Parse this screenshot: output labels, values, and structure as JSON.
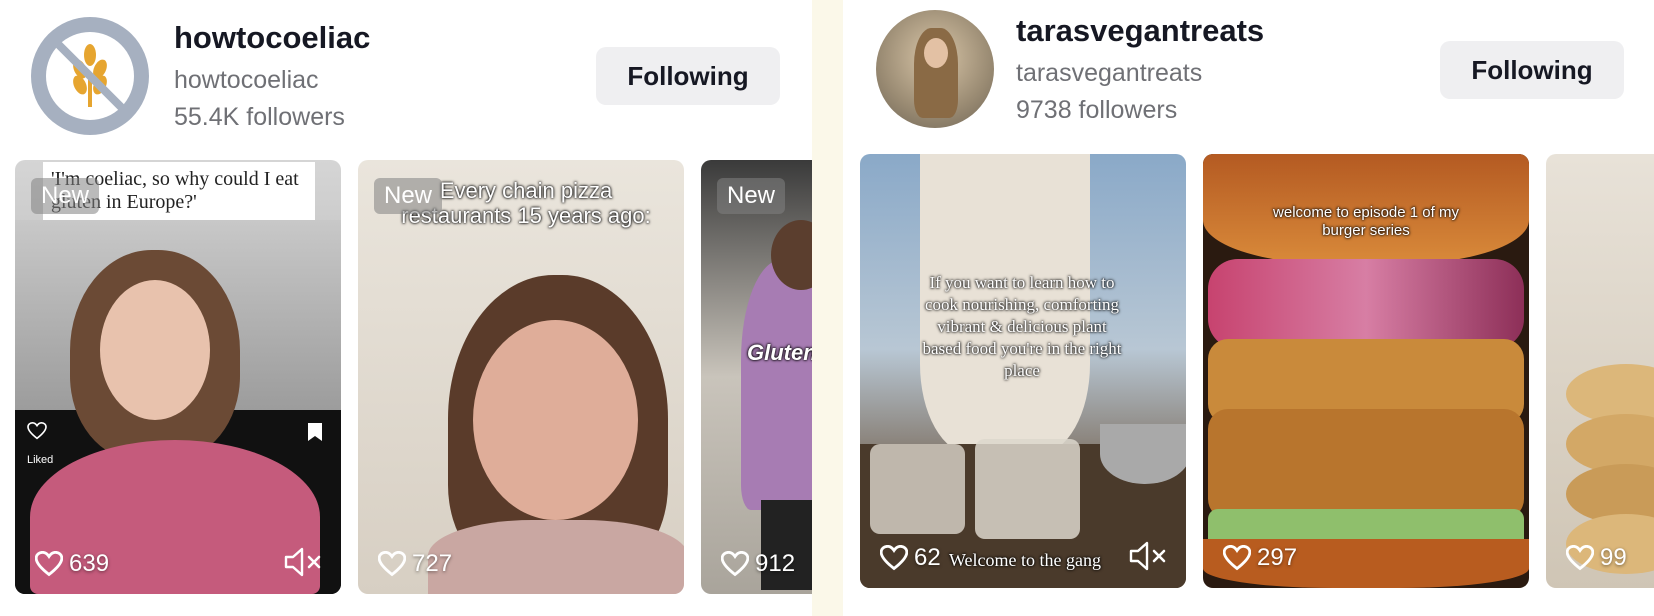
{
  "left": {
    "username": "howtocoeliac",
    "handle": "howtocoeliac",
    "followers": "55.4K followers",
    "follow_label": "Following",
    "cards": [
      {
        "badge": "New",
        "caption": "'I'm coeliac, so why could I eat gluten in Europe?'",
        "likes": "639",
        "ui_liked": "Liked"
      },
      {
        "badge": "New",
        "caption": "Every chain pizza restaurants 15 years ago:",
        "likes": "727"
      },
      {
        "badge": "New",
        "caption": "Gluten",
        "likes": "912"
      }
    ]
  },
  "right": {
    "username": "tarasvegantreats",
    "handle": "tarasvegantreats",
    "followers": "9738 followers",
    "follow_label": "Following",
    "cards": [
      {
        "caption": "If you want to learn how to cook nourishing, comforting vibrant & delicious plant based food you're in the right place",
        "likes": "62",
        "subcaption": "Welcome to the gang"
      },
      {
        "caption": "welcome to episode 1 of my burger series",
        "likes": "297"
      },
      {
        "likes": "99"
      }
    ]
  },
  "icons": [
    "wheat-crossed-icon",
    "heart-icon",
    "mute-icon",
    "bookmark-icon"
  ]
}
